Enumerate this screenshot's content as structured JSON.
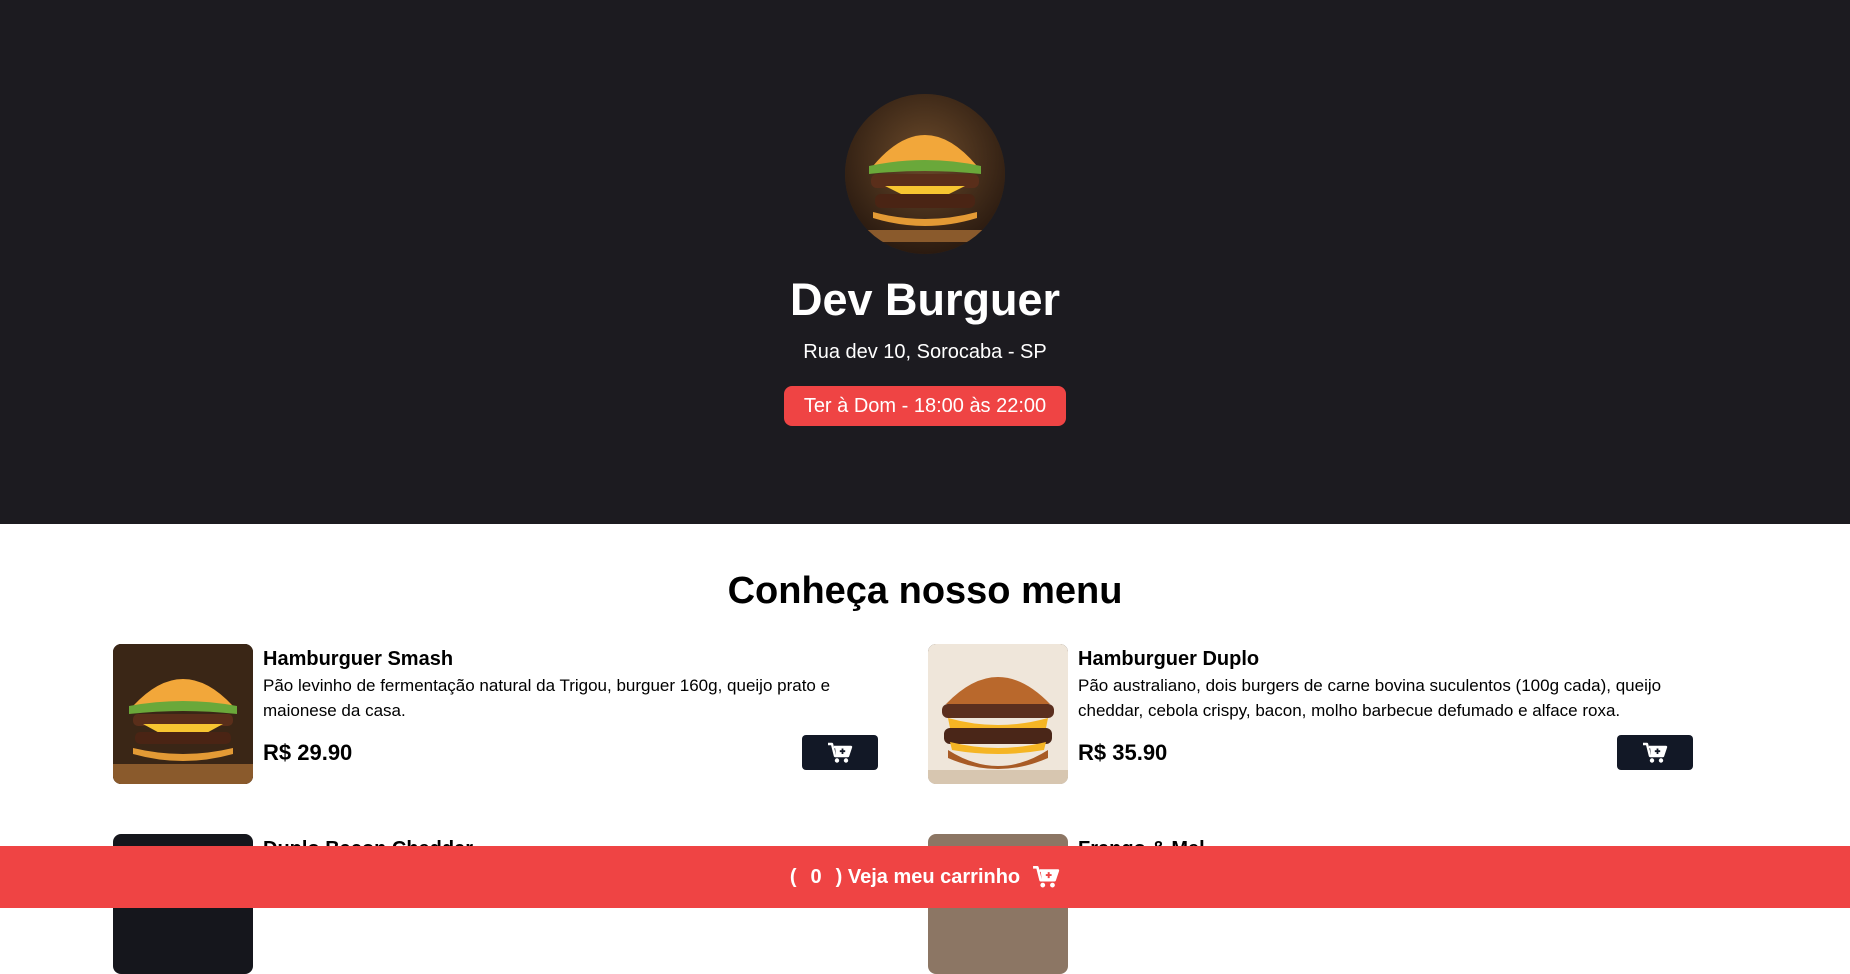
{
  "header": {
    "title": "Dev Burguer",
    "address": "Rua dev 10, Sorocaba - SP",
    "hours": "Ter à Dom - 18:00 às 22:00",
    "logo_icon": "burger-logo"
  },
  "menu": {
    "title": "Conheça nosso menu",
    "items": [
      {
        "name": "Hamburguer Smash",
        "description": "Pão levinho de fermentação natural da Trigou, burguer 160g, queijo prato e maionese da casa.",
        "price": "R$ 29.90",
        "icon": "add-to-cart-icon"
      },
      {
        "name": "Hamburguer Duplo",
        "description": "Pão australiano, dois burgers de carne bovina suculentos (100g cada), queijo cheddar, cebola crispy, bacon, molho barbecue defumado e alface roxa.",
        "price": "R$ 35.90",
        "icon": "add-to-cart-icon"
      },
      {
        "name": "Duplo Bacon Cheddar",
        "description": "",
        "price": "",
        "icon": "add-to-cart-icon"
      },
      {
        "name": "Frango & Mel",
        "description": "",
        "price": "",
        "icon": "add-to-cart-icon"
      }
    ]
  },
  "cart": {
    "open_paren": "(",
    "count": "0",
    "label": ") Veja meu carrinho",
    "icon": "cart-plus-icon"
  },
  "colors": {
    "hero_bg": "#1c1b20",
    "accent_red": "#ef4444",
    "button_dark": "#121826"
  }
}
